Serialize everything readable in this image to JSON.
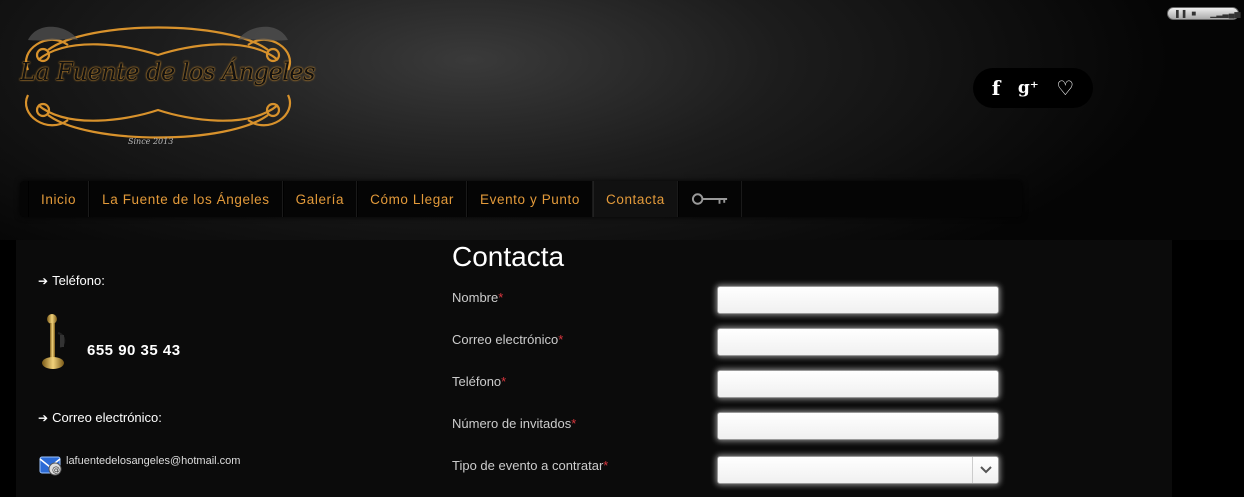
{
  "brand": {
    "name": "La Fuente de los Ángeles",
    "since": "Since 2013"
  },
  "player": {
    "pause_icon": "pause-icon",
    "stop_icon": "stop-icon",
    "volume_icon": "volume-icon"
  },
  "social": {
    "facebook": "f",
    "google_plus": "g⁺",
    "heart": "♡"
  },
  "nav": {
    "items": [
      {
        "label": "Inicio"
      },
      {
        "label": "La Fuente de los Ángeles"
      },
      {
        "label": "Galería"
      },
      {
        "label": "Cómo Llegar"
      },
      {
        "label": "Evento y Punto"
      },
      {
        "label": "Contacta"
      }
    ],
    "key_icon": "key-icon",
    "active": "Contacta"
  },
  "contact_info": {
    "phone_label": "Teléfono:",
    "phone_number": "655 90 35 43",
    "email_label": "Correo electrónico:",
    "email": "lafuentedelosangeles@hotmail.com"
  },
  "form": {
    "title": "Contacta",
    "fields": [
      {
        "label": "Nombre",
        "required": "*"
      },
      {
        "label": "Correo electrónico",
        "required": "*"
      },
      {
        "label": "Teléfono",
        "required": "*"
      },
      {
        "label": "Número de invitados",
        "required": "*"
      },
      {
        "label": "Tipo de evento a contratar",
        "required": "*"
      }
    ]
  },
  "colors": {
    "accent": "#e39a3a",
    "required": "#d9363e",
    "background": "#000000"
  }
}
